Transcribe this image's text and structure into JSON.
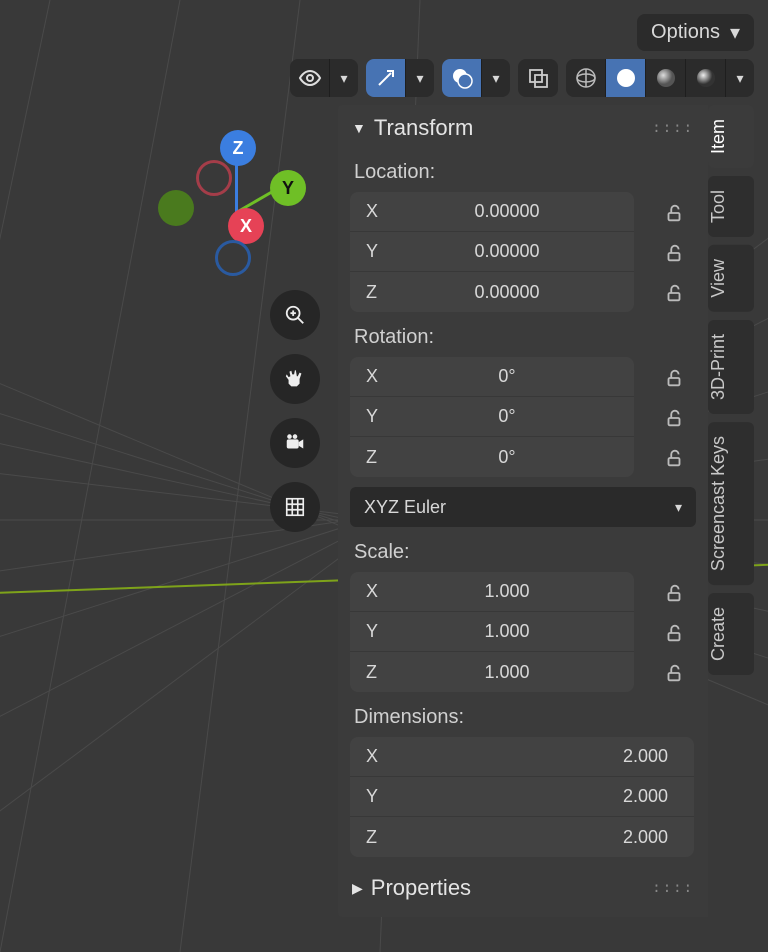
{
  "header": {
    "options_label": "Options"
  },
  "gizmo": {
    "x": "X",
    "y": "Y",
    "z": "Z"
  },
  "tabs": [
    "Item",
    "Tool",
    "View",
    "3D-Print",
    "Screencast Keys",
    "Create"
  ],
  "active_tab": "Item",
  "panel": {
    "title": "Transform",
    "location": {
      "label": "Location:",
      "x": {
        "axis": "X",
        "value": "0.00000"
      },
      "y": {
        "axis": "Y",
        "value": "0.00000"
      },
      "z": {
        "axis": "Z",
        "value": "0.00000"
      }
    },
    "rotation": {
      "label": "Rotation:",
      "x": {
        "axis": "X",
        "value": "0°"
      },
      "y": {
        "axis": "Y",
        "value": "0°"
      },
      "z": {
        "axis": "Z",
        "value": "0°"
      },
      "mode": "XYZ Euler"
    },
    "scale": {
      "label": "Scale:",
      "x": {
        "axis": "X",
        "value": "1.000"
      },
      "y": {
        "axis": "Y",
        "value": "1.000"
      },
      "z": {
        "axis": "Z",
        "value": "1.000"
      }
    },
    "dimensions": {
      "label": "Dimensions:",
      "x": {
        "axis": "X",
        "value": "2.000"
      },
      "y": {
        "axis": "Y",
        "value": "2.000"
      },
      "z": {
        "axis": "Z",
        "value": "2.000"
      }
    },
    "properties_title": "Properties"
  }
}
